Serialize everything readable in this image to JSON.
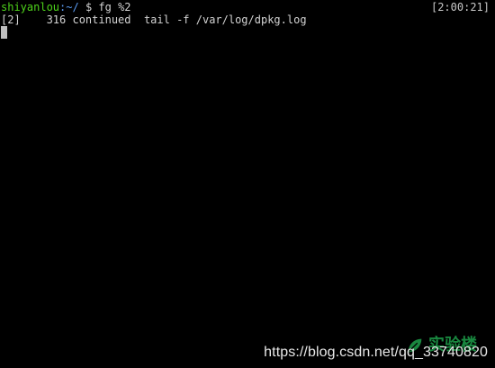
{
  "terminal": {
    "prompt_user_host": "shiyanlou",
    "prompt_path": ":~/",
    "prompt_symbol": " $ ",
    "command": "fg %2",
    "clock": "[2:00:21]",
    "output_line": "[2]    316 continued  tail -f /var/log/dpkg.log"
  },
  "watermark": {
    "url": "https://blog.csdn.net/qq_33740820",
    "brand": "实验楼"
  },
  "colors": {
    "background": "#000000",
    "prompt_user": "#4ed31a",
    "prompt_path": "#5a9bf2",
    "text": "#d3d3d3",
    "brand": "#1e9f4a"
  },
  "icons": {
    "logo": "leaf-logo-icon"
  }
}
